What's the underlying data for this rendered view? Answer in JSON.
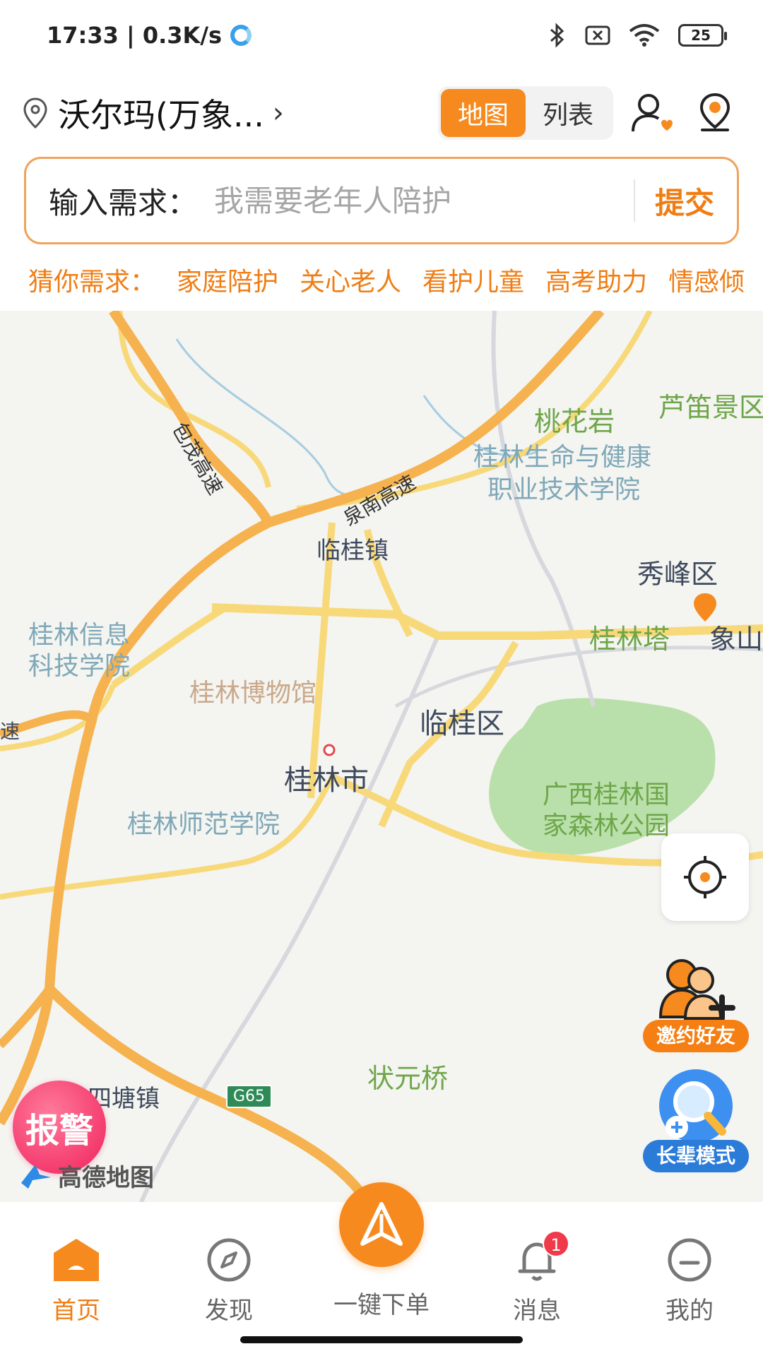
{
  "status_bar": {
    "time_speed": "17:33 | 0.3K/s",
    "battery": "25"
  },
  "header": {
    "location": "沃尔玛(万象...",
    "view_toggle": {
      "map": "地图",
      "list": "列表",
      "active": "map"
    }
  },
  "request": {
    "label": "输入需求：",
    "placeholder": "我需要老年人陪护",
    "submit": "提交"
  },
  "guess": {
    "label": "猜你需求：",
    "items": [
      "家庭陪护",
      "关心老人",
      "看护儿童",
      "高考助力",
      "情感倾"
    ]
  },
  "map": {
    "labels": {
      "taohuayan": "桃花岩",
      "ludijing": "芦笛景区",
      "college_health": "桂林生命与健康",
      "college_health_2": "职业技术学院",
      "baoji": "包茂高速",
      "quannan": "泉南高速",
      "linguizhen": "临桂镇",
      "xiufeng": "秀峰区",
      "guilinta": "桂林塔",
      "xiangshan": "象山",
      "xinxi_1": "桂林信息",
      "xinxi_2": "科技学院",
      "museum": "桂林博物馆",
      "linguiqu": "临桂区",
      "guilinshi": "桂林市",
      "forest_1": "广西桂林国",
      "forest_2": "家森林公园",
      "normal": "桂林师范学院",
      "su": "速",
      "zhuangyuan": "状元桥",
      "sitang": "四塘镇",
      "g65": "G65"
    },
    "buttons": {
      "invite": "邀约好友",
      "elder_mode": "长辈模式",
      "alarm": "报警"
    },
    "attribution": "高德地图",
    "colors": {
      "highway": "#f5b24e",
      "road": "#f8d97a",
      "park": "#aedc9d",
      "accent": "#f68a1f"
    }
  },
  "nav": {
    "items": [
      "首页",
      "发现",
      "一键下单",
      "消息",
      "我的"
    ],
    "active": "首页",
    "message_badge": "1"
  }
}
